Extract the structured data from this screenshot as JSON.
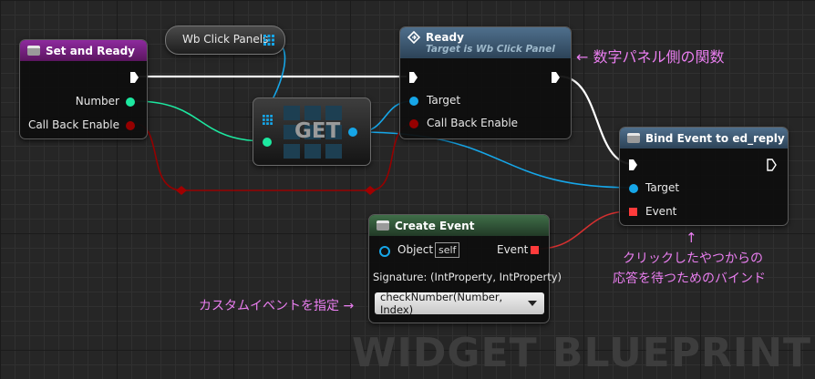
{
  "nodes": {
    "set_and_ready": {
      "title": "Set and Ready",
      "pins": {
        "number": "Number",
        "call_back_enable": "Call Back Enable"
      }
    },
    "wb_click_panels": {
      "label": "Wb Click Panels"
    },
    "get": {
      "label": "GET"
    },
    "ready": {
      "title": "Ready",
      "subtitle": "Target is Wb Click Panel",
      "pins": {
        "target": "Target",
        "call_back_enable": "Call Back Enable"
      }
    },
    "bind_event": {
      "title": "Bind Event to ed_reply",
      "pins": {
        "target": "Target",
        "event": "Event"
      }
    },
    "create_event": {
      "title": "Create Event",
      "object_label": "Object",
      "object_value": "self",
      "event_label": "Event",
      "signature": "Signature: (IntProperty, IntProperty)",
      "function_selected": "checkNumber(Number, Index)"
    }
  },
  "annotations": {
    "ready_note": "← 数字パネル側の関数",
    "bind_arrow": "↑",
    "bind_line1": "クリックしたやつからの",
    "bind_line2": "応答を待つためのバインド",
    "create_note": "カスタムイベントを指定 →"
  },
  "watermark": "WIDGET BLUEPRINT",
  "colors": {
    "exec_wire": "#ffffff",
    "int_pin": "#1de8a0",
    "object_pin": "#16a6e8",
    "bool_pin": "#950000",
    "delegate_pin": "#ff3b3b",
    "annotation": "#ea7ef0",
    "custom_header": "#7a1e88",
    "function_header": "#3a5a78",
    "event_header": "#2f5a37"
  }
}
